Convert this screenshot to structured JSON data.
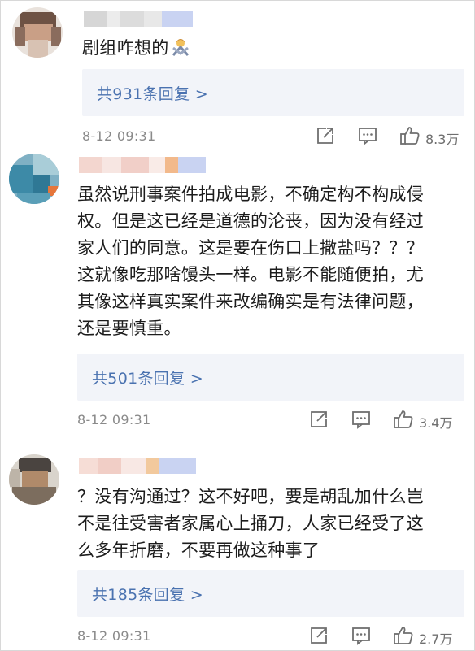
{
  "comments": [
    {
      "text_lines": [
        "剧组咋想的"
      ],
      "emoji": "person-gesturing-no-emoji",
      "reply_label": "共931条回复 >",
      "time": "8-12 09:31",
      "likes": "8.3万"
    },
    {
      "text_lines": [
        "虽然说刑事案件拍成电影，不确定构不构成侵",
        "权。但是这已经是道德的沦丧，因为没有经过",
        "家人们的同意。这是要在伤口上撒盐吗？？？",
        "这就像吃那啥馒头一样。电影不能随便拍，尤",
        "其像这样真实案件来改编确实是有法律问题，",
        "还是要慎重。"
      ],
      "reply_label": "共501条回复 >",
      "time": "8-12 09:31",
      "likes": "3.4万"
    },
    {
      "text_lines": [
        "？没有沟通过？这不好吧，要是胡乱加什么岂",
        "不是往受害者家属心上捅刀，人家已经受了这",
        "么多年折磨，不要再做这种事了"
      ],
      "reply_label": "共185条回复 >",
      "time": "8-12 09:31",
      "likes": "2.7万"
    }
  ],
  "icons": {
    "share": "share-icon",
    "comment": "comment-icon",
    "like": "thumbs-up-icon"
  },
  "colors": {
    "reply_link": "#4a72b0",
    "reply_bg": "#f2f4f9",
    "meta_gray": "#8a8a8a"
  }
}
